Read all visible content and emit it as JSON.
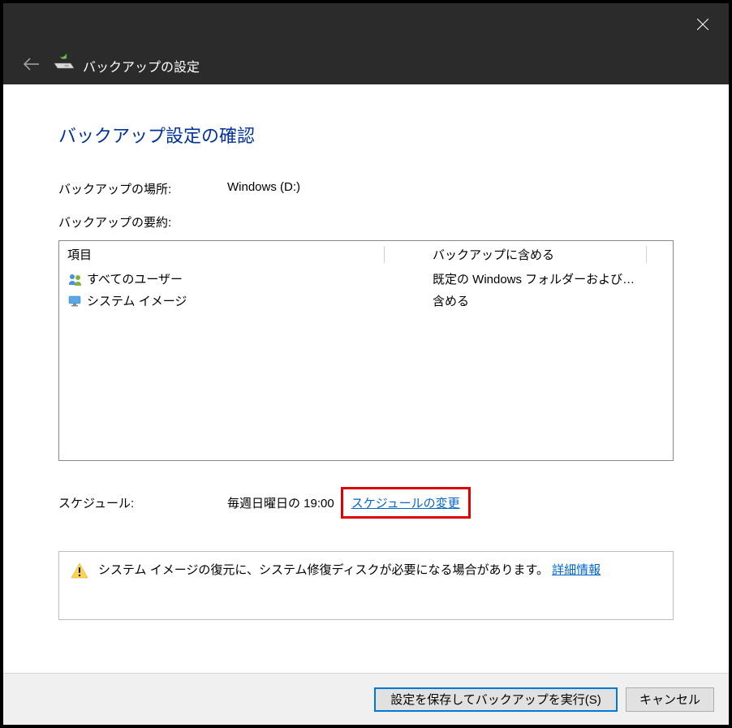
{
  "window": {
    "title": "バックアップの設定"
  },
  "main": {
    "heading": "バックアップ設定の確認",
    "location_label": "バックアップの場所:",
    "location_value": "Windows (D:)",
    "summary_label": "バックアップの要約:",
    "table": {
      "header_item": "項目",
      "header_include": "バックアップに含める",
      "rows": [
        {
          "item": "すべてのユーザー",
          "include": "既定の Windows フォルダーおよび…"
        },
        {
          "item": "システム イメージ",
          "include": "含める"
        }
      ]
    },
    "schedule_label": "スケジュール:",
    "schedule_value": "毎週日曜日の 19:00",
    "schedule_link": "スケジュールの変更",
    "info_text": "システム イメージの復元に、システム修復ディスクが必要になる場合があります。",
    "info_link": "詳細情報"
  },
  "footer": {
    "save_label": "設定を保存してバックアップを実行(S)",
    "cancel_label": "キャンセル"
  }
}
